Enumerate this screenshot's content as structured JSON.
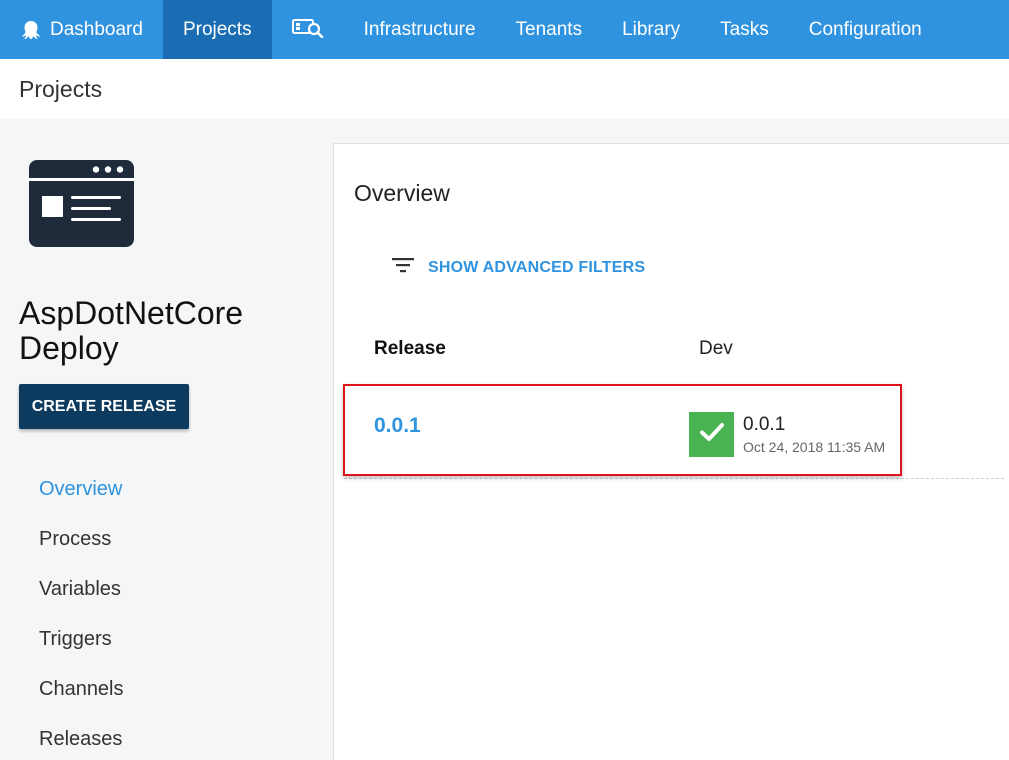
{
  "nav": {
    "items": [
      {
        "label": "Dashboard",
        "icon": "octopus-logo-icon"
      },
      {
        "label": "Projects"
      },
      {
        "label": "",
        "icon": "search-machine-icon"
      },
      {
        "label": "Infrastructure"
      },
      {
        "label": "Tenants"
      },
      {
        "label": "Library"
      },
      {
        "label": "Tasks"
      },
      {
        "label": "Configuration"
      }
    ],
    "active_index": 1,
    "colors": {
      "bar": "#2f93e0",
      "active": "#1a6db3"
    }
  },
  "breadcrumb": {
    "title": "Projects"
  },
  "sidebar": {
    "project_icon": "project-window-icon",
    "project_name": "AspDotNetCore Deploy",
    "create_release_label": "CREATE RELEASE",
    "items": [
      {
        "label": "Overview"
      },
      {
        "label": "Process"
      },
      {
        "label": "Variables"
      },
      {
        "label": "Triggers"
      },
      {
        "label": "Channels"
      },
      {
        "label": "Releases"
      }
    ],
    "active_index": 0
  },
  "main": {
    "title": "Overview",
    "filter_icon": "filter-icon",
    "filter_label": "SHOW ADVANCED FILTERS",
    "columns": {
      "release": "Release",
      "environment": "Dev"
    },
    "rows": [
      {
        "release": "0.0.1",
        "deployment": {
          "status": "success",
          "status_icon": "checkmark-icon",
          "status_color": "#48b350",
          "version": "0.0.1",
          "date": "Oct 24, 2018 11:35 AM"
        }
      }
    ]
  }
}
